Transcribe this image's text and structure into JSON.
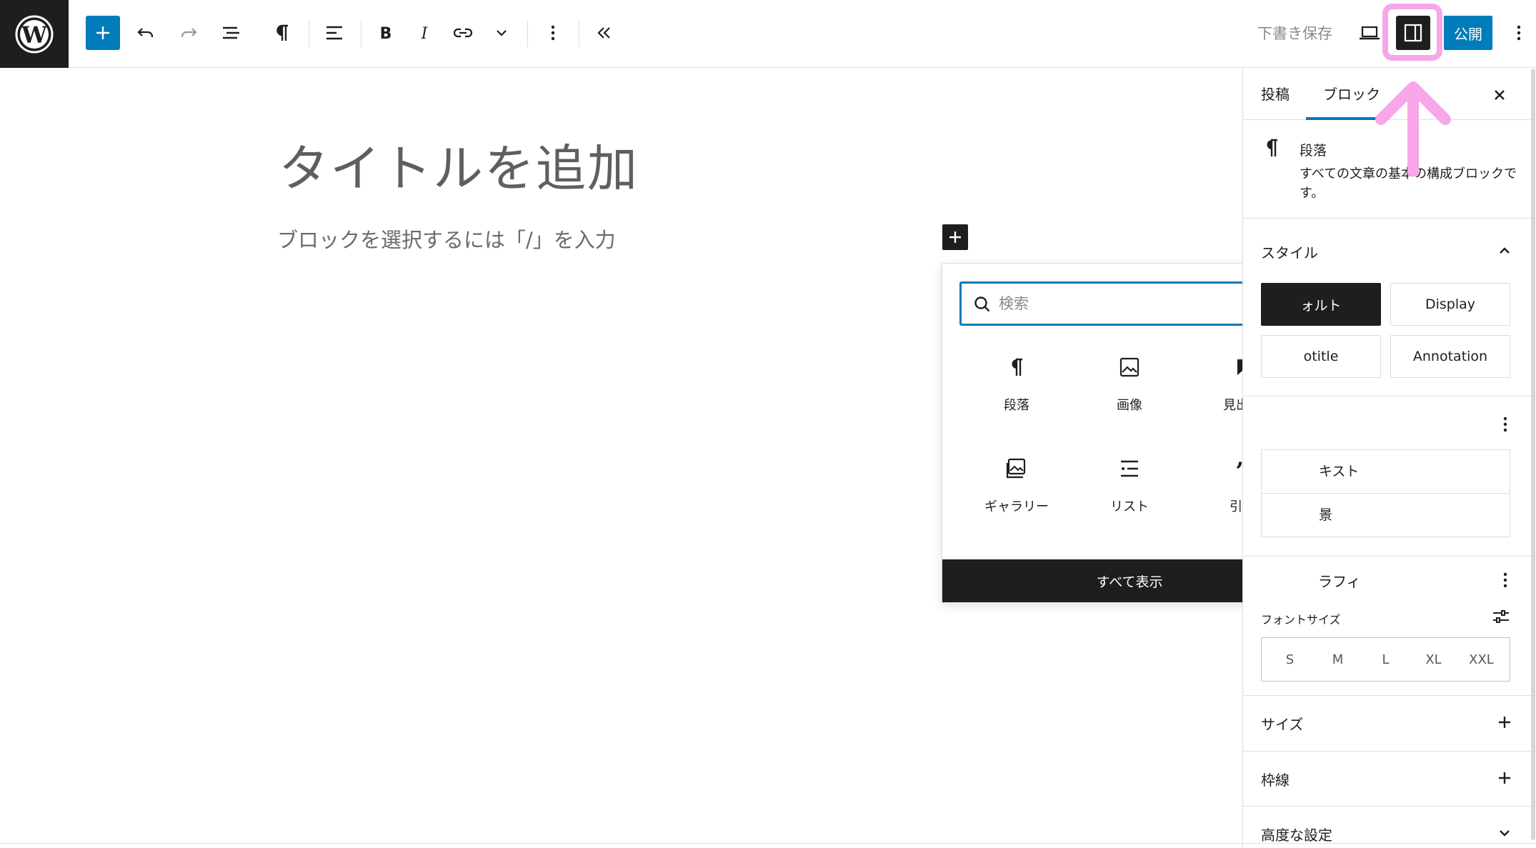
{
  "toolbar": {
    "add_block": "+",
    "draft_save": "下書き保存",
    "publish": "公開"
  },
  "editor": {
    "title_placeholder": "タイトルを追加",
    "block_placeholder": "ブロックを選択するには「/」を入力"
  },
  "inserter": {
    "search_placeholder": "検索",
    "blocks": [
      {
        "label": "段落",
        "icon": "paragraph-icon"
      },
      {
        "label": "画像",
        "icon": "image-icon"
      },
      {
        "label": "見出し",
        "icon": "heading-bookmark-icon"
      },
      {
        "label": "ギャラリー",
        "icon": "gallery-icon"
      },
      {
        "label": "リスト",
        "icon": "list-icon"
      },
      {
        "label": "引用",
        "icon": "quote-icon"
      }
    ],
    "show_all": "すべて表示"
  },
  "sidebar": {
    "tabs": [
      "投稿",
      "ブロック"
    ],
    "active_tab": "ブロック",
    "block_card": {
      "title": "段落",
      "description": "すべての文章の基本の構成ブロックです。"
    },
    "styles_title": "スタイル",
    "styles": [
      "ォルト",
      "Display",
      "otitle",
      "Annotation"
    ],
    "color_items": [
      "キスト",
      "景"
    ],
    "typography_title": "ラフィ",
    "font_size_label": "フォントサイズ",
    "font_sizes": [
      "S",
      "M",
      "L",
      "XL",
      "XXL"
    ],
    "size_title": "サイズ",
    "border_title": "枠線",
    "advanced_title": "高度な設定"
  },
  "colors": {
    "accent": "#007cba",
    "highlight": "#f7a6e8",
    "dark": "#1e1e1e"
  }
}
